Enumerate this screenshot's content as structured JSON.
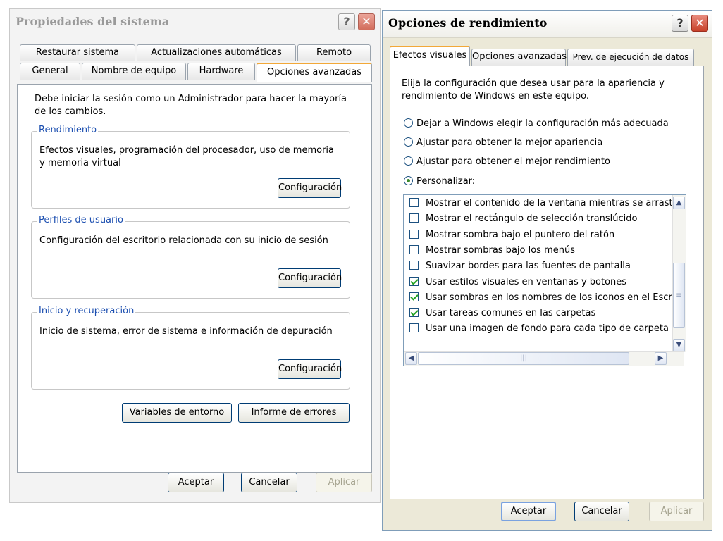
{
  "system_window": {
    "title": "Propiedades del sistema",
    "help_glyph": "?",
    "close_glyph": "✕",
    "tabs_row1": [
      "Restaurar sistema",
      "Actualizaciones automáticas",
      "Remoto"
    ],
    "tabs_row2": [
      "General",
      "Nombre de equipo",
      "Hardware",
      "Opciones avanzadas"
    ],
    "active_tab": "Opciones avanzadas",
    "admin_notice": "Debe iniciar la sesión como un Administrador para hacer la mayoría de los cambios.",
    "performance": {
      "label": "Rendimiento",
      "description": "Efectos visuales, programación del procesador, uso de memoria y memoria virtual",
      "button": "Configuración"
    },
    "user_profiles": {
      "label": "Perfiles de usuario",
      "description": "Configuración del escritorio relacionada con su inicio de sesión",
      "button": "Configuración"
    },
    "startup_recovery": {
      "label": "Inicio y recuperación",
      "description": "Inicio de sistema, error de sistema e información de depuración",
      "button": "Configuración"
    },
    "env_vars_button": "Variables de entorno",
    "error_report_button": "Informe de errores",
    "ok_button": "Aceptar",
    "cancel_button": "Cancelar",
    "apply_button": "Aplicar"
  },
  "perf_window": {
    "title": "Opciones de rendimiento",
    "help_glyph": "?",
    "close_glyph": "✕",
    "tabs": [
      "Efectos visuales",
      "Opciones avanzadas",
      "Prev. de ejecución de datos"
    ],
    "active_tab": "Efectos visuales",
    "intro": "Elija la configuración que desea usar para la apariencia y rendimiento de Windows en este equipo.",
    "radios": [
      {
        "label": "Dejar a Windows elegir la configuración más adecuada",
        "selected": false
      },
      {
        "label": "Ajustar para obtener la mejor apariencia",
        "selected": false
      },
      {
        "label": "Ajustar para obtener el mejor rendimiento",
        "selected": false
      },
      {
        "label": "Personalizar:",
        "selected": true
      }
    ],
    "options": [
      {
        "label": "Mostrar el contenido de la ventana mientras se arrastra",
        "checked": false
      },
      {
        "label": "Mostrar el rectángulo de selección translúcido",
        "checked": false
      },
      {
        "label": "Mostrar sombra bajo el puntero del ratón",
        "checked": false
      },
      {
        "label": "Mostrar sombras bajo los menús",
        "checked": false
      },
      {
        "label": "Suavizar bordes para las fuentes de pantalla",
        "checked": false
      },
      {
        "label": "Usar estilos visuales en ventanas y botones",
        "checked": true
      },
      {
        "label": "Usar sombras en los nombres de los iconos en el Escritorio",
        "checked": true
      },
      {
        "label": "Usar tareas comunes en las carpetas",
        "checked": true
      },
      {
        "label": "Usar una imagen de fondo para cada tipo de carpeta",
        "checked": false
      }
    ],
    "scroll_up_glyph": "▲",
    "scroll_down_glyph": "▼",
    "scroll_left_glyph": "◀",
    "scroll_right_glyph": "▶",
    "ok_button": "Aceptar",
    "cancel_button": "Cancelar",
    "apply_button": "Aplicar"
  }
}
